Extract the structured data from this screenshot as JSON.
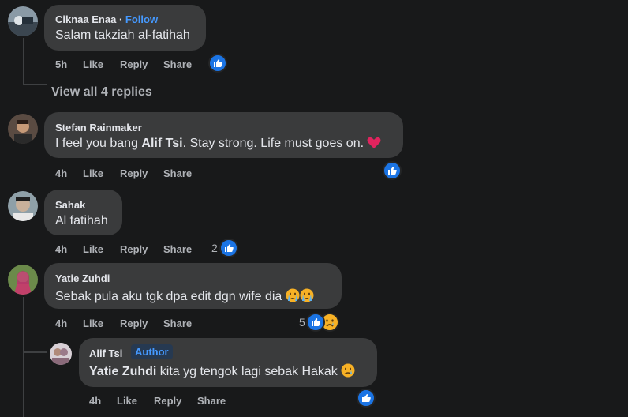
{
  "comments": [
    {
      "author": "Ciknaa Enaa",
      "follow_label": "Follow",
      "text": "Salam takziah al-fatihah",
      "time": "5h",
      "actions": [
        "Like",
        "Reply",
        "Share"
      ],
      "reaction_count": ""
    },
    {
      "author": "Stefan Rainmaker",
      "text_pre": "I feel you bang ",
      "text_mention": "Alif Tsi",
      "text_post": ". Stay strong. Life must goes on.",
      "time": "4h",
      "actions": [
        "Like",
        "Reply",
        "Share"
      ],
      "reaction_count": ""
    },
    {
      "author": "Sahak",
      "text": "Al fatihah",
      "time": "4h",
      "actions": [
        "Like",
        "Reply",
        "Share"
      ],
      "reaction_count": "2"
    },
    {
      "author": "Yatie Zuhdi",
      "text": "Sebak pula aku tgk dpa edit dgn wife dia",
      "time": "4h",
      "actions": [
        "Like",
        "Reply",
        "Share"
      ],
      "reaction_count": "5"
    }
  ],
  "view_replies": "View all 4 replies",
  "reply": {
    "author": "Alif Tsi",
    "author_badge": "Author",
    "mention": "Yatie Zuhdi",
    "text": " kita yg tengok lagi sebak Hakak",
    "time": "4h",
    "actions": [
      "Like",
      "Reply",
      "Share"
    ]
  },
  "colors": {
    "background": "#18191a",
    "bubble": "#3a3b3c",
    "accent": "#4599ff",
    "like": "#1b74e4"
  },
  "icons": [
    "like-icon",
    "heart-emoji",
    "crying-emoji",
    "sad-emoji"
  ]
}
